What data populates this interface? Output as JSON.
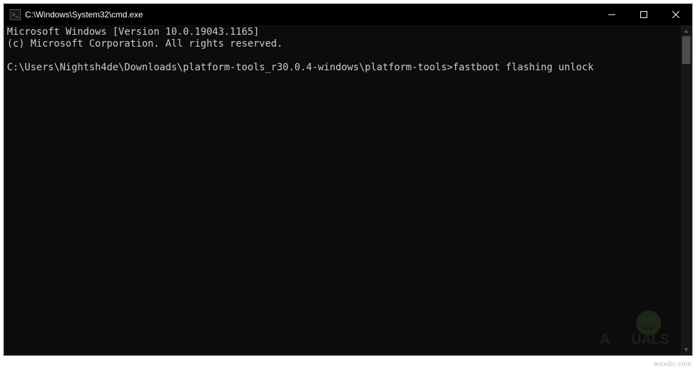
{
  "titlebar": {
    "icon_name": "cmd-icon",
    "title": "C:\\Windows\\System32\\cmd.exe"
  },
  "terminal": {
    "line1": "Microsoft Windows [Version 10.0.19043.1165]",
    "line2": "(c) Microsoft Corporation. All rights reserved.",
    "blank": "",
    "prompt": "C:\\Users\\Nightsh4de\\Downloads\\platform-tools_r30.0.4-windows\\platform-tools>",
    "command": "fastboot flashing unlock"
  },
  "watermark": "wsxdn.com"
}
